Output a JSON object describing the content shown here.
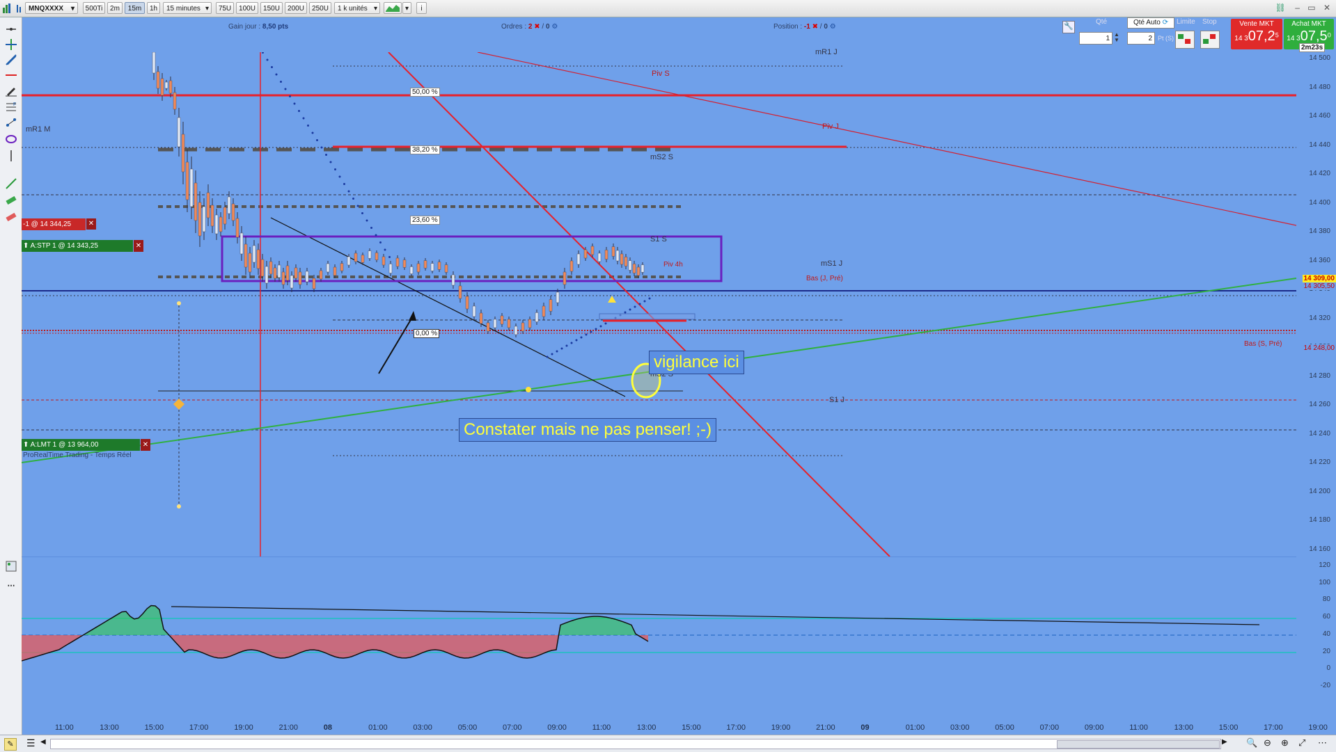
{
  "toolbar": {
    "symbol": "MNQXXXX",
    "timeframes": [
      "500Ti",
      "2m",
      "15m",
      "1h"
    ],
    "selected_timeframe": "15m",
    "interval_select": "15 minutes",
    "unit_buttons": [
      "75U",
      "100U",
      "150U",
      "200U",
      "250U"
    ],
    "units_select": "1 k unités",
    "info_icon": "i"
  },
  "infobar": {
    "gain_label": "Gain jour :",
    "gain_value": "8,50 pts",
    "orders_label": "Ordres :",
    "orders_count": "2",
    "orders_zero": "0",
    "position_label": "Position :",
    "position_value": "-1",
    "position_zero": "0"
  },
  "order_panel": {
    "qty_label": "Qté",
    "qty_value": "1",
    "qty_auto_label": "Qté Auto",
    "qty_auto_value": "2",
    "pts_label": "Pt (S)",
    "limit_label": "Limite",
    "stop_label": "Stop",
    "sell_label": "Vente MKT",
    "sell_price_small": "14 3",
    "sell_price_big": "07,2",
    "sell_price_sup": "5",
    "buy_label": "Achat MKT",
    "buy_price_small": "14 3",
    "buy_price_big": "07,5",
    "buy_price_sup": "0"
  },
  "timer": "2m23s",
  "price_axis": [
    "14 500",
    "14 480",
    "14 460",
    "14 440",
    "14 420",
    "14 400",
    "14 380",
    "14 360",
    "14 340",
    "14 320",
    "14 300",
    "14 280",
    "14 260",
    "14 240",
    "14 220",
    "14 200",
    "14 180",
    "14 160"
  ],
  "price_tags": {
    "last": "14 309,00",
    "level2": "14 305,50",
    "bas": "14 248,00"
  },
  "levels": {
    "mR1J": "mR1 J",
    "pivS": "Piv S",
    "pivJ": "Piv J",
    "mR1M": "mR1 M",
    "mS2S_top": "mS2 S",
    "S1S": "S1 S",
    "mS1J": "mS1 J",
    "piv4h": "Piv 4h",
    "basJPre": "Bas (J, Pré)",
    "basSPre": "Bas (S, Pré)",
    "mS2S": "mS2 S",
    "S1J": "S1 J"
  },
  "fib": {
    "f50": "50,00 %",
    "f38": "38,20 %",
    "f23": "23,60 %",
    "f0": "0,00 %"
  },
  "trades": {
    "short_pos": "-1 @ 14 344,25",
    "stop_order": "A:STP  1 @ 14 343,25",
    "limit_order": "A:LMT  1 @ 13 964,00",
    "platform_label": "ProRealTime Trading - Temps Réel"
  },
  "annotations": {
    "vigilance": "vigilance ici",
    "constater": "Constater mais ne pas penser! ;-)"
  },
  "indicator_axis": [
    "120",
    "100",
    "80",
    "60",
    "40",
    "20",
    "0",
    "-20"
  ],
  "time_axis": [
    "11:00",
    "13:00",
    "15:00",
    "17:00",
    "19:00",
    "21:00",
    "08",
    "01:00",
    "03:00",
    "05:00",
    "07:00",
    "09:00",
    "11:00",
    "13:00",
    "15:00",
    "17:00",
    "19:00",
    "21:00",
    "09",
    "01:00",
    "03:00",
    "05:00",
    "07:00",
    "09:00",
    "11:00",
    "13:00",
    "15:00",
    "17:00",
    "19:00"
  ],
  "colors": {
    "chart_bg": "#6fa0ea",
    "red": "#e8202a",
    "green": "#3bb043",
    "purple": "#6a1fbf",
    "yellow": "#ffff3b",
    "buy": "#2fae3d",
    "sell": "#e02a2a"
  }
}
